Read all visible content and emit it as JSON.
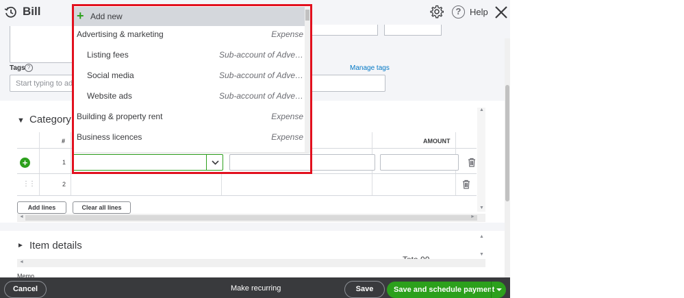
{
  "header": {
    "title": "Bill",
    "help_label": "Help"
  },
  "tags": {
    "label": "Tags",
    "help_glyph": "?",
    "manage_label": "Manage tags",
    "placeholder": "Start typing to ad"
  },
  "category": {
    "title": "Category",
    "collapse_glyph": "▼",
    "col_num": "#",
    "col_amount": "AMOUNT",
    "rows": [
      {
        "num": "1"
      },
      {
        "num": "2"
      }
    ],
    "add_lines_label": "Add lines",
    "clear_lines_label": "Clear all lines"
  },
  "item_details": {
    "title": "Item details",
    "expand_glyph": "►",
    "total_fragment": "Tota          00",
    "memo_fragment": "Memo"
  },
  "dropdown": {
    "add_new_label": "Add new",
    "items": [
      {
        "name": "Advertising & marketing",
        "type": "Expense",
        "indent": false
      },
      {
        "name": "Listing fees",
        "type": "Sub-account of Adve…",
        "indent": true
      },
      {
        "name": "Social media",
        "type": "Sub-account of Adve…",
        "indent": true
      },
      {
        "name": "Website ads",
        "type": "Sub-account of Adve…",
        "indent": true
      },
      {
        "name": "Building & property rent",
        "type": "Expense",
        "indent": false
      },
      {
        "name": "Business licences",
        "type": "Expense",
        "indent": false
      }
    ]
  },
  "footer": {
    "cancel_label": "Cancel",
    "recurring_label": "Make recurring",
    "save_label": "Save",
    "save_schedule_label": "Save and schedule payment"
  },
  "colors": {
    "accent_green": "#2ca01c",
    "footer_bg": "#393a3d",
    "highlight_frame": "#e2101e",
    "link_blue": "#0077c5"
  }
}
